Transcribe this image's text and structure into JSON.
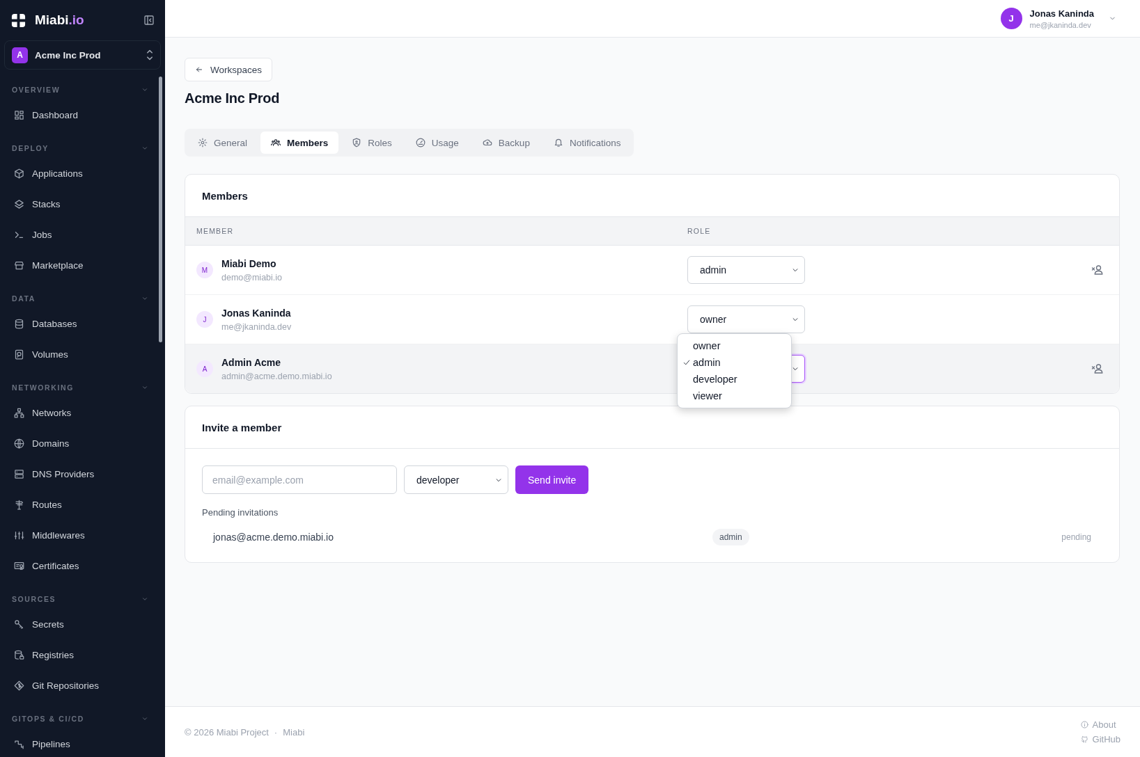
{
  "sidebar": {
    "brand": {
      "name": "Miabi",
      "suffix": ".io"
    },
    "workspace": {
      "initial": "A",
      "name": "Acme Inc Prod"
    },
    "sections": [
      {
        "title": "OVERVIEW",
        "expanded": true,
        "items": [
          "Dashboard"
        ]
      },
      {
        "title": "DEPLOY",
        "expanded": true,
        "items": [
          "Applications",
          "Stacks",
          "Jobs",
          "Marketplace"
        ]
      },
      {
        "title": "DATA",
        "expanded": true,
        "items": [
          "Databases",
          "Volumes"
        ]
      },
      {
        "title": "NETWORKING",
        "expanded": true,
        "items": [
          "Networks",
          "Domains",
          "DNS Providers",
          "Routes",
          "Middlewares",
          "Certificates"
        ]
      },
      {
        "title": "SOURCES",
        "expanded": true,
        "items": [
          "Secrets",
          "Registries",
          "Git Repositories"
        ]
      },
      {
        "title": "GITOPS & CI/CD",
        "expanded": true,
        "items": [
          "Pipelines"
        ]
      }
    ]
  },
  "header": {
    "user": {
      "initial": "J",
      "name": "Jonas Kaninda",
      "email": "me@jkaninda.dev"
    }
  },
  "back_button": "Workspaces",
  "title": "Acme Inc Prod",
  "tabs": [
    {
      "label": "General",
      "selected": false
    },
    {
      "label": "Members",
      "selected": true
    },
    {
      "label": "Roles",
      "selected": false
    },
    {
      "label": "Usage",
      "selected": false
    },
    {
      "label": "Backup",
      "selected": false
    },
    {
      "label": "Notifications",
      "selected": false
    }
  ],
  "members": {
    "title": "Members",
    "columns": [
      "MEMBER",
      "ROLE"
    ],
    "rows": [
      {
        "initial": "M",
        "name": "Miabi Demo",
        "email": "demo@miabi.io",
        "role": "admin",
        "removable": true,
        "hovered": false,
        "menu_open": false
      },
      {
        "initial": "J",
        "name": "Jonas Kaninda",
        "email": "me@jkaninda.dev",
        "role": "owner",
        "removable": false,
        "hovered": false,
        "menu_open": false
      },
      {
        "initial": "A",
        "name": "Admin Acme",
        "email": "admin@acme.demo.miabi.io",
        "removable": true,
        "hovered": true,
        "menu_open": true
      }
    ],
    "role_menu": [
      {
        "label": "owner",
        "selected": false
      },
      {
        "label": "admin",
        "selected": true
      },
      {
        "label": "developer",
        "selected": false
      },
      {
        "label": "viewer",
        "selected": false
      }
    ]
  },
  "invite": {
    "title": "Invite a member",
    "email": {
      "placeholder": "email@example.com"
    },
    "role": "developer",
    "button": "Send invite",
    "pending_title": "Pending invitations",
    "pending": [
      {
        "email": "jonas@acme.demo.miabi.io",
        "role": "admin",
        "status": "pending"
      }
    ]
  },
  "footer": {
    "copyright": "© 2026 Miabi Project",
    "separator": "·",
    "project_link": "Miabi",
    "links": [
      "About",
      "GitHub"
    ]
  }
}
